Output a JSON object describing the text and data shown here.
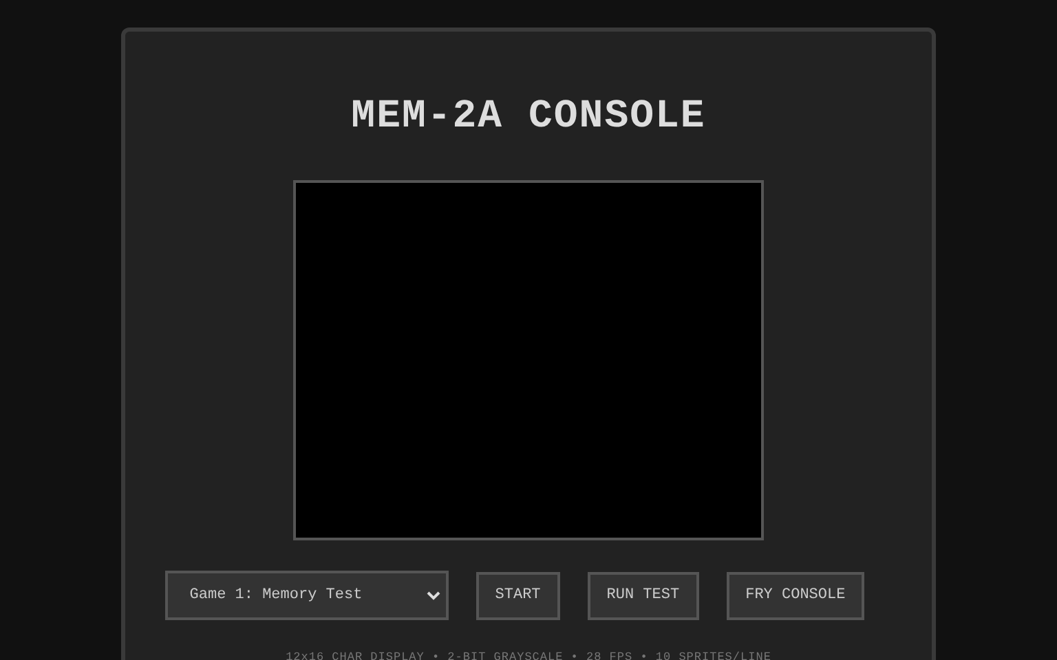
{
  "title": "MEM-2A CONSOLE",
  "game_select": {
    "value": "Game 1: Memory Test"
  },
  "buttons": [
    {
      "label": "START"
    },
    {
      "label": "RUN TEST"
    },
    {
      "label": "FRY CONSOLE"
    }
  ],
  "specs": "12x16 CHAR DISPLAY • 2-BIT GRAYSCALE • 28 FPS • 10 SPRITES/LINE"
}
